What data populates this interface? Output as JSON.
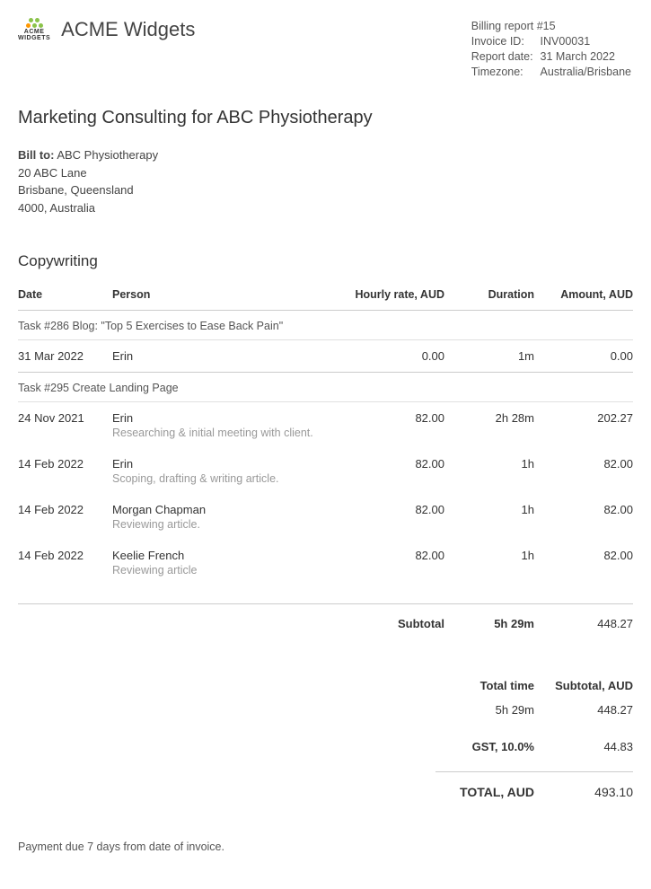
{
  "header": {
    "logo_text_line1": "ACME",
    "logo_text_line2": "WIDGETS",
    "company_name": "ACME Widgets",
    "meta": {
      "billing_report": "Billing report #15",
      "invoice_label": "Invoice ID:",
      "invoice_val": "INV00031",
      "date_label": "Report date:",
      "date_val": "31 March 2022",
      "tz_label": "Timezone:",
      "tz_val": "Australia/Brisbane"
    }
  },
  "title": "Marketing Consulting for ABC Physiotherapy",
  "bill_to": {
    "label": "Bill to:",
    "name": "ABC Physiotherapy",
    "line1": "20 ABC Lane",
    "line2": "Brisbane, Queensland",
    "line3": "4000, Australia"
  },
  "section": "Copywriting",
  "columns": {
    "date": "Date",
    "person": "Person",
    "rate": "Hourly rate, AUD",
    "duration": "Duration",
    "amount": "Amount, AUD"
  },
  "task1": {
    "title": "Task #286 Blog: \"Top 5 Exercises to Ease Back Pain\"",
    "e0": {
      "date": "31 Mar 2022",
      "person": "Erin",
      "rate": "0.00",
      "dur": "1m",
      "amt": "0.00"
    }
  },
  "task2": {
    "title": "Task #295 Create Landing Page",
    "e0": {
      "date": "24 Nov 2021",
      "person": "Erin",
      "note": "Researching & initial meeting with client.",
      "rate": "82.00",
      "dur": "2h 28m",
      "amt": "202.27"
    },
    "e1": {
      "date": "14 Feb 2022",
      "person": "Erin",
      "note": "Scoping, drafting & writing article.",
      "rate": "82.00",
      "dur": "1h",
      "amt": "82.00"
    },
    "e2": {
      "date": "14 Feb 2022",
      "person": "Morgan Chapman",
      "note": "Reviewing article.",
      "rate": "82.00",
      "dur": "1h",
      "amt": "82.00"
    },
    "e3": {
      "date": "14 Feb 2022",
      "person": "Keelie French",
      "note": "Reviewing article",
      "rate": "82.00",
      "dur": "1h",
      "amt": "82.00"
    }
  },
  "subtotal": {
    "label": "Subtotal",
    "dur": "5h 29m",
    "amt": "448.27"
  },
  "summary": {
    "time_label": "Total time",
    "sub_label": "Subtotal, AUD",
    "time_val": "5h 29m",
    "sub_val": "448.27",
    "gst_label": "GST, 10.0%",
    "gst_val": "44.83",
    "total_label": "TOTAL, AUD",
    "total_val": "493.10"
  },
  "footer": "Payment due 7 days from date of invoice."
}
